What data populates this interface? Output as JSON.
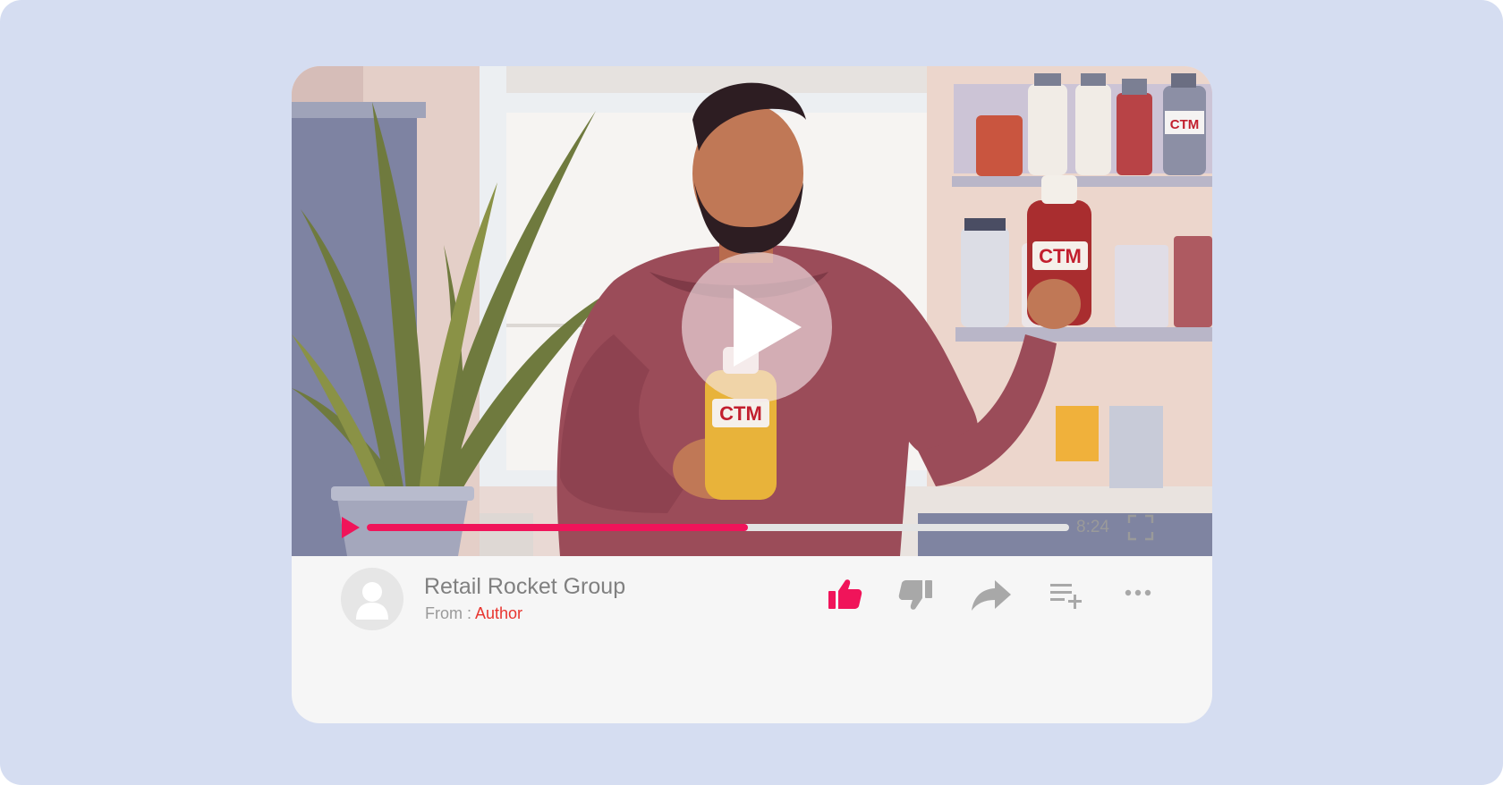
{
  "player": {
    "duration": "8:24",
    "progress_fraction": 0.543,
    "accent_color": "#f0145a"
  },
  "channel": {
    "name": "Retail Rocket Group",
    "from_label": "From :",
    "from_value": "Author"
  },
  "thumbnail": {
    "bottle_labels": [
      "CTM",
      "CTM",
      "CTM",
      "CTM"
    ]
  },
  "actions": [
    {
      "icon": "thumbs-up-icon",
      "active": true
    },
    {
      "icon": "thumbs-down-icon",
      "active": false
    },
    {
      "icon": "share-icon",
      "active": false
    },
    {
      "icon": "add-to-playlist-icon",
      "active": false
    },
    {
      "icon": "more-icon",
      "active": false
    }
  ],
  "colors": {
    "background": "#d5ddf1",
    "card": "#f6f6f6",
    "icon_inactive": "#a8a8a8",
    "author_link": "#e8352f"
  }
}
